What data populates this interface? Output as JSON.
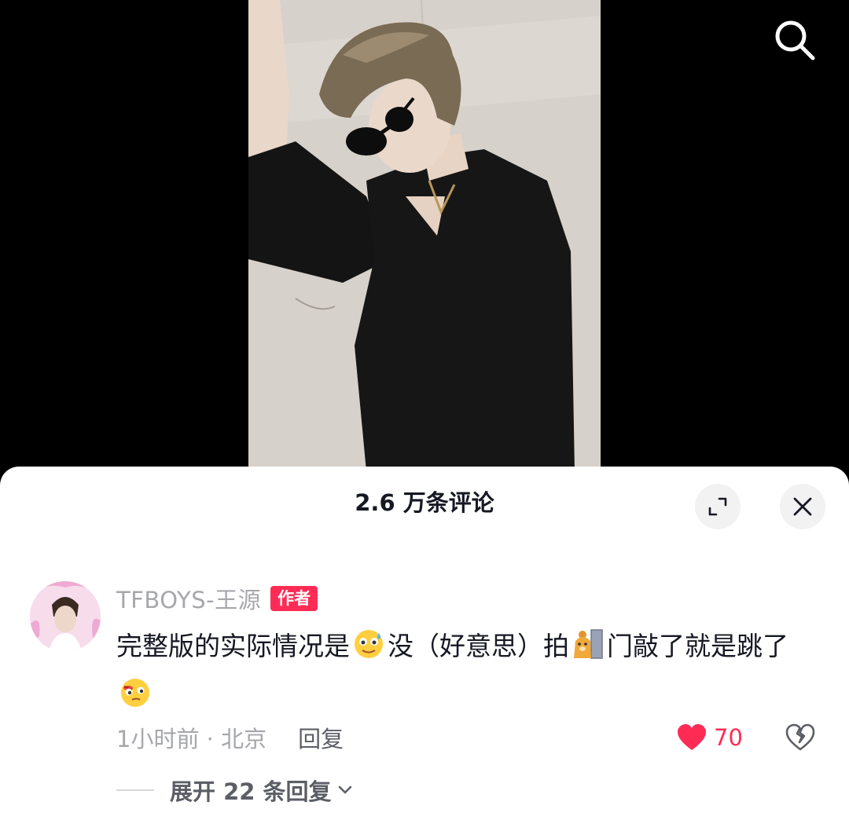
{
  "video": {
    "search_icon": "search-icon"
  },
  "comments_panel": {
    "title": "2.6 万条评论",
    "expand_icon": "expand-icon",
    "close_icon": "close-icon"
  },
  "comment": {
    "author": "TFBOYS-王源",
    "badge": "作者",
    "text_part1": "完整版的实际情况是",
    "text_part2": "没（好意思）拍",
    "text_part3": "门敲了就是跳了",
    "emoji1": "sweating-smile-emoji",
    "emoji2": "bear-door-emoji",
    "emoji3": "flushed-wink-emoji",
    "meta": "1小时前 · 北京",
    "reply_label": "回复",
    "likes": "70",
    "like_icon": "heart-icon",
    "dislike_icon": "broken-heart-icon",
    "expand_replies": "展开 22 条回复",
    "accent_color": "#fe2c55"
  }
}
